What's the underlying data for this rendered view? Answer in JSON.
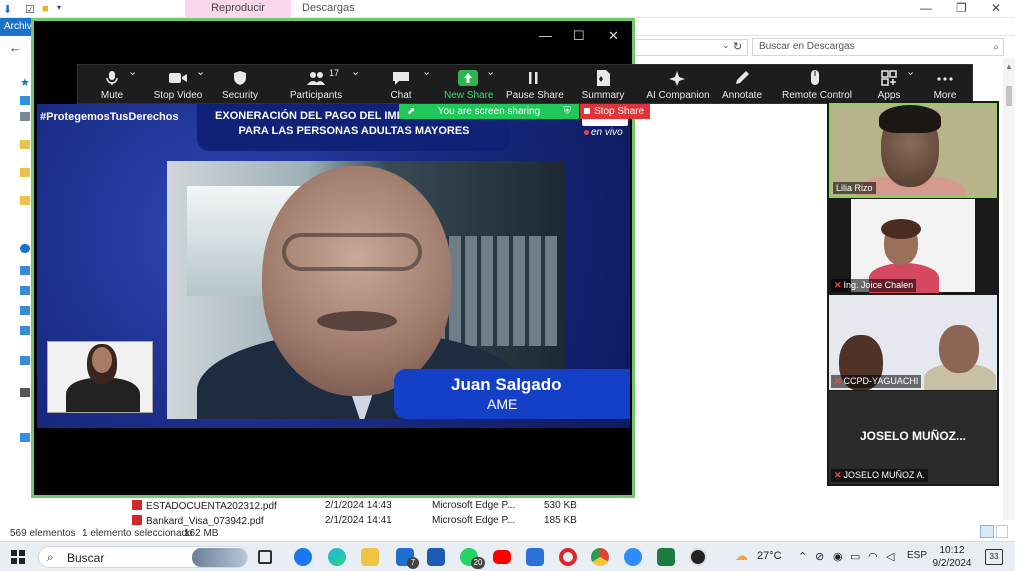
{
  "explorer": {
    "ribbon_tab_active": "Reproducir",
    "ribbon_tab": "Descargas",
    "file_tab": "Archivo",
    "search_placeholder": "Buscar en Descargas",
    "files": [
      {
        "name": "ESTADOCUENTA202312.pdf",
        "date": "2/1/2024 14:43",
        "type": "Microsoft Edge P...",
        "size": "530 KB"
      },
      {
        "name": "Bankard_Visa_073942.pdf",
        "date": "2/1/2024 14:41",
        "type": "Microsoft Edge P...",
        "size": "185 KB"
      }
    ],
    "status": {
      "items": "569 elementos",
      "selected": "1 elemento seleccionado",
      "selected_size": "162 MB"
    }
  },
  "zoom_toolbar": {
    "mute": "Mute",
    "stop_video": "Stop Video",
    "security": "Security",
    "participants": "Participants",
    "participants_count": "17",
    "chat": "Chat",
    "new_share": "New Share",
    "pause_share": "Pause Share",
    "summary": "Summary",
    "ai_companion": "AI Companion",
    "annotate": "Annotate",
    "remote_control": "Remote Control",
    "apps": "Apps",
    "more": "More"
  },
  "share_banner": {
    "text": "You are screen sharing",
    "stop": "Stop Share"
  },
  "broadcast": {
    "hashtag": "#ProtegemosTusDerechos",
    "headline_line1": "EXONERACIÓN DEL PAGO DEL IMPUESTO PREDIAL",
    "headline_line2": "PARA LAS PERSONAS ADULTAS MAYORES",
    "live": "en vivo",
    "speaker_name": "Juan Salgado",
    "speaker_org": "AME"
  },
  "participants": [
    {
      "name": "Lilia Rizo",
      "muted": false
    },
    {
      "name": "Ing. Joice Chalen",
      "muted": true
    },
    {
      "name": "CCPD-YAGUACHI",
      "muted": true
    },
    {
      "name": "JOSELO MUÑOZ A.",
      "display": "JOSELO  MUÑOZ...",
      "muted": true
    }
  ],
  "taskbar": {
    "search": "Buscar",
    "mail_badge": "7",
    "whatsapp_badge": "20",
    "weather": "27°C",
    "language": "ESP",
    "time": "10:12",
    "date": "9/2/2024",
    "notifications": "33"
  },
  "colors": {
    "zoom_border": "#74c76f",
    "share_green": "#20c85b",
    "stop_red": "#e0343a",
    "broadcast_blue": "#1c2f8c"
  }
}
